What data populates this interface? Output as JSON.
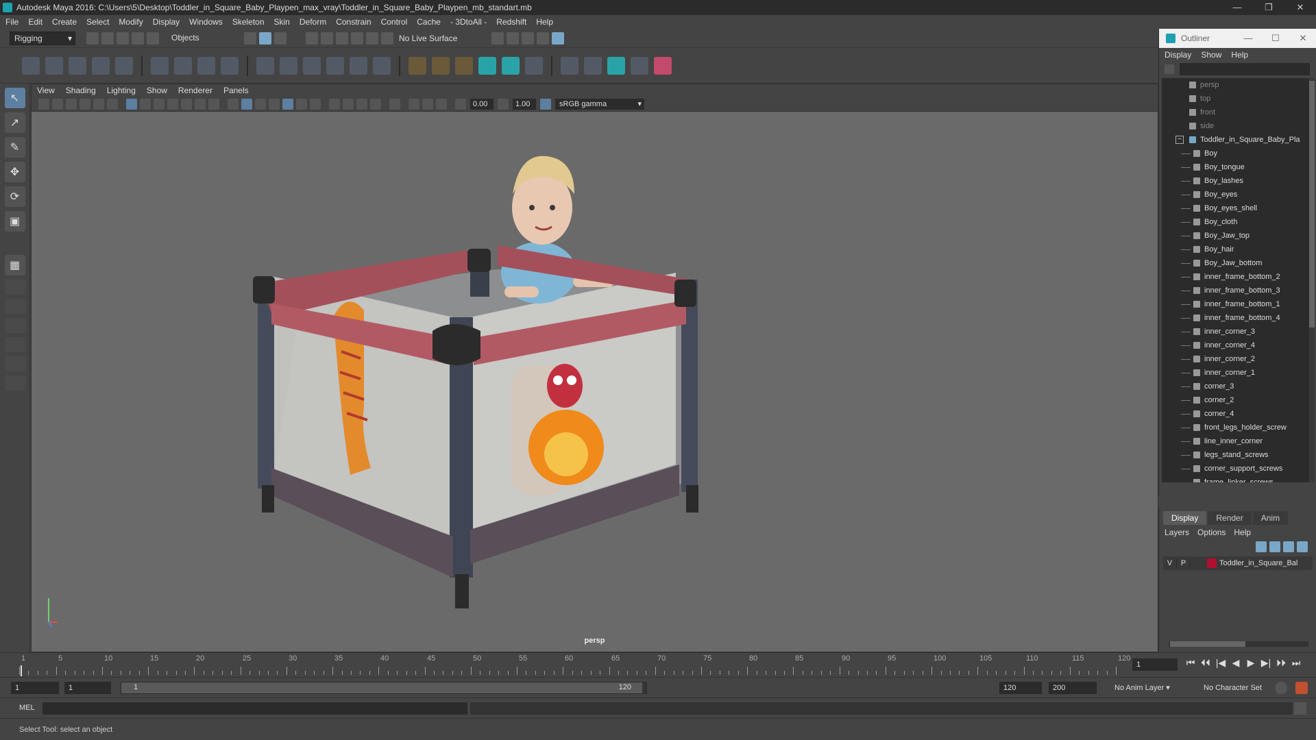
{
  "window": {
    "title": "Autodesk Maya 2016: C:\\Users\\5\\Desktop\\Toddler_in_Square_Baby_Playpen_max_vray\\Toddler_in_Square_Baby_Playpen_mb_standart.mb",
    "controls": [
      "—",
      "❐",
      "✕"
    ]
  },
  "menubar": [
    "File",
    "Edit",
    "Create",
    "Select",
    "Modify",
    "Display",
    "Windows",
    "Skeleton",
    "Skin",
    "Deform",
    "Constrain",
    "Control",
    "Cache",
    "- 3DtoAll -",
    "Redshift",
    "Help"
  ],
  "statusline": {
    "mode": "Rigging",
    "objects_label": "Objects",
    "live_surface": "No Live Surface"
  },
  "viewport": {
    "menu": [
      "View",
      "Shading",
      "Lighting",
      "Show",
      "Renderer",
      "Panels"
    ],
    "value_a": "0.00",
    "value_b": "1.00",
    "gamma": "sRGB gamma",
    "camera": "persp"
  },
  "outliner": {
    "title": "Outliner",
    "menu": [
      "Display",
      "Show",
      "Help"
    ],
    "cameras": [
      "persp",
      "top",
      "front",
      "side"
    ],
    "root": "Toddler_in_Square_Baby_Pla",
    "children": [
      "Boy",
      "Boy_tongue",
      "Boy_lashes",
      "Boy_eyes",
      "Boy_eyes_shell",
      "Boy_cloth",
      "Boy_Jaw_top",
      "Boy_hair",
      "Boy_Jaw_bottom",
      "inner_frame_bottom_2",
      "inner_frame_bottom_3",
      "inner_frame_bottom_1",
      "inner_frame_bottom_4",
      "inner_corner_3",
      "inner_corner_4",
      "inner_corner_2",
      "inner_corner_1",
      "corner_3",
      "corner_2",
      "corner_4",
      "front_legs_holder_screw",
      "line_inner_corner",
      "legs_stand_screws",
      "corner_support_screws",
      "frame_linker_screws"
    ]
  },
  "layers": {
    "tabs": [
      "Display",
      "Render",
      "Anim"
    ],
    "menu": [
      "Layers",
      "Options",
      "Help"
    ],
    "row": {
      "v": "V",
      "p": "P",
      "name": "Toddler_in_Square_Bal",
      "color": "#b01030"
    }
  },
  "timeline": {
    "labels": [
      "1",
      "5",
      "10",
      "15",
      "20",
      "25",
      "30",
      "35",
      "40",
      "45",
      "50",
      "55",
      "60",
      "65",
      "70",
      "75",
      "80",
      "85",
      "90",
      "95",
      "100",
      "105",
      "110",
      "115",
      "120"
    ],
    "current_frame": "1",
    "controls": [
      "⏮",
      "⏴⏴",
      "|◀",
      "◀",
      "▶",
      "▶|",
      "⏵⏵",
      "⏭"
    ]
  },
  "range": {
    "start": "1",
    "start2": "1",
    "bar_start": "1",
    "bar_end": "120",
    "end": "120",
    "end2": "200",
    "anim_layer": "No Anim Layer",
    "char_set": "No Character Set"
  },
  "command": {
    "label": "MEL"
  },
  "help": {
    "text": "Select Tool: select an object"
  }
}
